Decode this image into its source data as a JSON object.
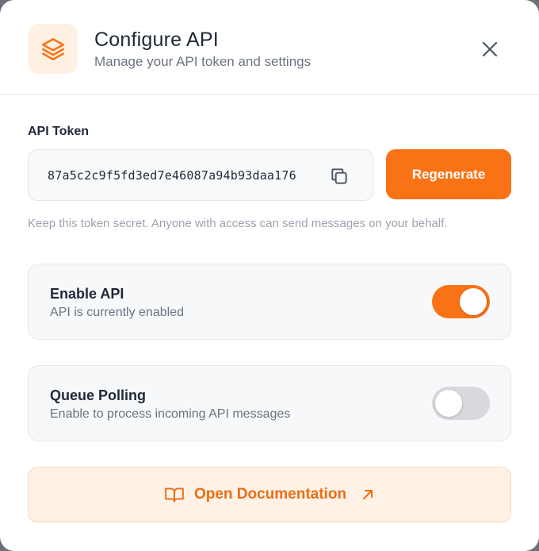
{
  "header": {
    "title": "Configure API",
    "subtitle": "Manage your API token and settings",
    "icon": "layers-icon",
    "close_icon": "close-icon"
  },
  "token": {
    "label": "API Token",
    "value": "87a5c2c9f5fd3ed7e46087a94b93daa176",
    "copy_icon": "copy-icon",
    "regenerate_label": "Regenerate",
    "hint": "Keep this token secret. Anyone with access can send messages on your behalf."
  },
  "settings": [
    {
      "title": "Enable API",
      "description": "API is currently enabled",
      "enabled": true
    },
    {
      "title": "Queue Polling",
      "description": "Enable to process incoming API messages",
      "enabled": false
    }
  ],
  "docs": {
    "label": "Open Documentation",
    "icon": "book-open-icon",
    "external_icon": "arrow-up-right-icon"
  },
  "colors": {
    "accent": "#f97316",
    "accent_light": "#fff1e6",
    "toggle_off": "#d7d9de"
  }
}
